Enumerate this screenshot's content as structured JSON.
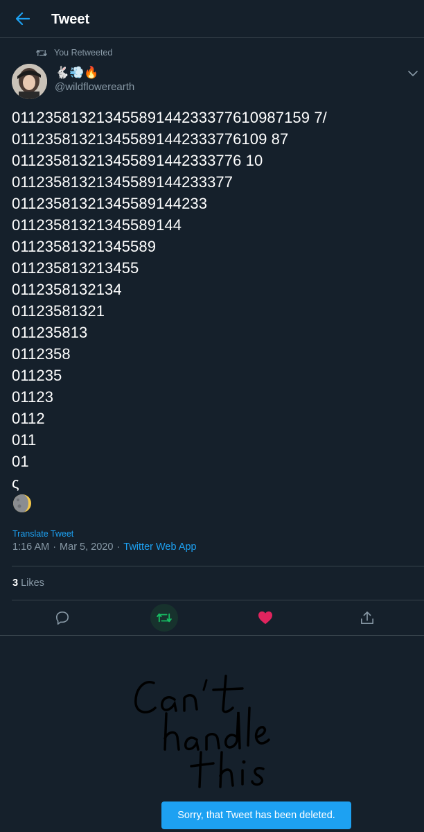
{
  "header": {
    "title": "Tweet",
    "back_icon": "arrow-left-icon"
  },
  "retweet_context": {
    "label": "You Retweeted",
    "icon": "retweet-icon"
  },
  "author": {
    "display_name": "🐇💨🔥",
    "handle": "@wildflowerearth"
  },
  "tweet": {
    "lines": [
      "01123581321345589144233377610987159 7/",
      "011235813213455891442333776109 87",
      "011235813213455891442333776 10",
      "01123581321345589144233377",
      "01123581321345589144233",
      "01123581321345589144",
      "01123581321345589",
      "011235813213455",
      "0112358132134",
      "01123581321",
      "011235813",
      "0112358",
      "011235",
      "01123",
      "0112",
      "011",
      "01",
      "ς"
    ],
    "emoji": "🌘"
  },
  "translate_label": "Translate Tweet",
  "meta": {
    "time": "1:16 AM",
    "date": "Mar 5, 2020",
    "separator": "·",
    "source": "Twitter Web App"
  },
  "likes": {
    "count": "3",
    "label": "Likes"
  },
  "actions": {
    "reply_icon": "reply-icon",
    "retweet_icon": "retweet-icon",
    "like_icon": "heart-icon",
    "share_icon": "share-icon"
  },
  "colors": {
    "background": "#15202b",
    "accent": "#1da1f2",
    "retweet_green": "#17bf63",
    "like_red": "#e0245e",
    "muted": "#8899a6",
    "border": "#38444d"
  },
  "handwriting": {
    "text": "Can't handle this"
  },
  "toast": {
    "message": "Sorry, that Tweet has been deleted."
  }
}
